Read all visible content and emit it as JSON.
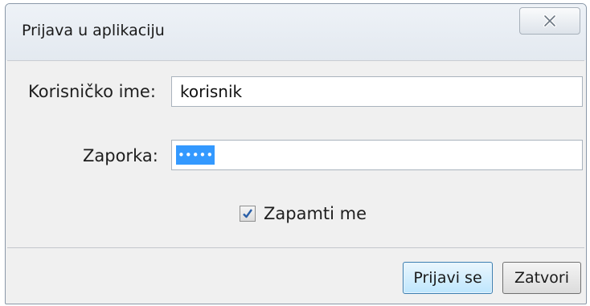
{
  "window": {
    "title": "Prijava u aplikaciju",
    "close_icon": "close-x-icon"
  },
  "form": {
    "username_label": "Korisničko ime:",
    "username_value": "korisnik",
    "password_label": "Zaporka:",
    "password_value": "•••••",
    "remember_label": "Zapamti me",
    "remember_checked": true
  },
  "buttons": {
    "login_label": "Prijavi se",
    "close_label": "Zatvori"
  },
  "colors": {
    "selection": "#3399ff",
    "primary_border": "#3c7fb1",
    "check": "#2a5fa8"
  }
}
